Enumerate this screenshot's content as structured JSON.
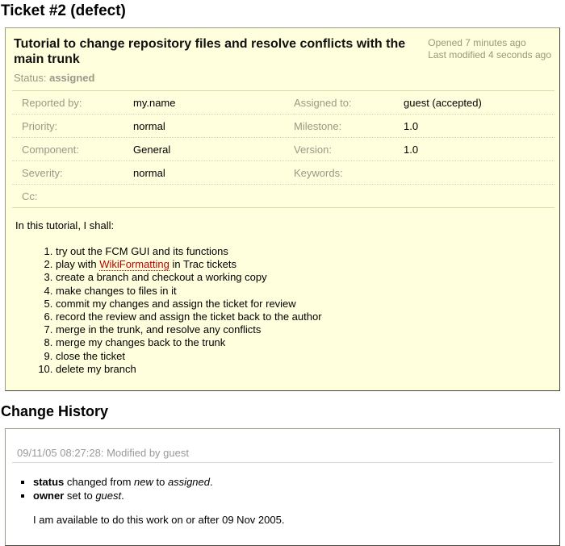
{
  "colors": {
    "ticket_background": "#ffffdd",
    "box_border": "#999988",
    "property_label": "#999988",
    "status_text": "#999988",
    "date_info_text": "#999977",
    "missing_link": "#bb0000",
    "change_date_text": "#999999",
    "change_rule": "#d7d7d7"
  },
  "page": {
    "title": "Ticket #2 (defect)"
  },
  "ticket": {
    "summary": "Tutorial to change repository files and resolve conflicts with the main trunk",
    "opened": "Opened 7 minutes ago",
    "last_modified": "Last modified 4 seconds ago",
    "status_label": "Status:",
    "status_value": "assigned",
    "properties": {
      "rows": [
        {
          "l1": "Reported by:",
          "v1": "my.name",
          "l2": "Assigned to:",
          "v2": "guest (accepted)"
        },
        {
          "l1": "Priority:",
          "v1": "normal",
          "l2": "Milestone:",
          "v2": "1.0"
        },
        {
          "l1": "Component:",
          "v1": "General",
          "l2": "Version:",
          "v2": "1.0"
        },
        {
          "l1": "Severity:",
          "v1": "normal",
          "l2": "Keywords:",
          "v2": ""
        },
        {
          "l1": "Cc:",
          "v1": "",
          "l2": "",
          "v2": ""
        }
      ]
    },
    "description": {
      "intro": "In this tutorial, I shall:",
      "list": {
        "i1": "try out the FCM GUI and its functions",
        "i2a": "play with ",
        "i2b": "WikiFormatting",
        "i2c": " in Trac tickets",
        "i3": "create a branch and checkout a working copy",
        "i4": "make changes to files in it",
        "i5": "commit my changes and assign the ticket for review",
        "i6": "record the review and assign the ticket back to the author",
        "i7": "merge in the trunk, and resolve any conflicts",
        "i8": "merge my changes back to the trunk",
        "i9": "close the ticket",
        "i10": "delete my branch"
      }
    }
  },
  "history": {
    "heading": "Change History",
    "entry": {
      "date_line": "09/11/05 08:27:28: Modified by guest",
      "changes": {
        "c1_field": "status",
        "c1_mid1": " changed from ",
        "c1_old": "new",
        "c1_mid2": " to ",
        "c1_new": "assigned",
        "c1_end": ".",
        "c2_field": "owner",
        "c2_mid": " set to ",
        "c2_val": "guest",
        "c2_end": "."
      },
      "comment": "I am available to do this work on or after 09 Nov 2005."
    }
  }
}
